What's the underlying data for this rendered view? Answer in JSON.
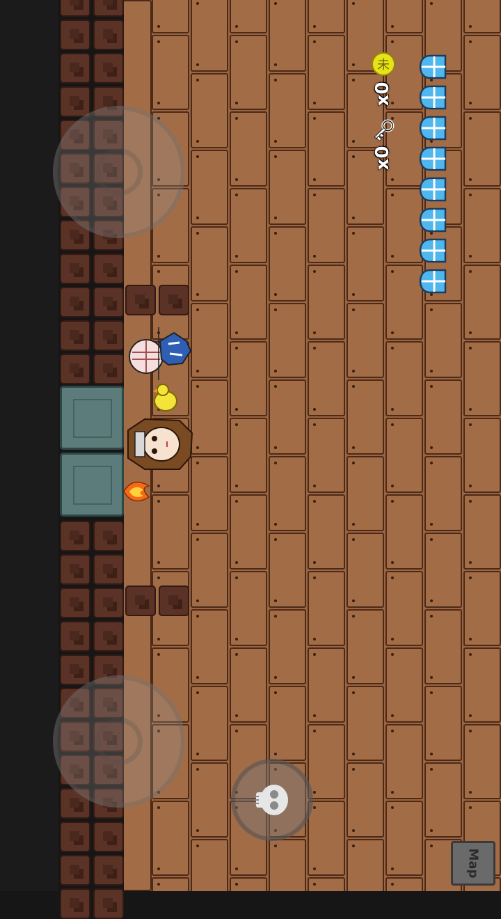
{
  "hud": {
    "coin_count": "x0",
    "key_count": "x0",
    "shields": 8,
    "coin_glyph": "未"
  },
  "buttons": {
    "map_label": "Map"
  },
  "icons": [
    "coin-icon",
    "key-icon",
    "shield-icon",
    "skull-icon",
    "fire-icon",
    "duck-icon"
  ],
  "colors": {
    "floor": "#9c6440",
    "brick": "#5b3326",
    "door": "#5b7c7a",
    "shield": "#4fb7ee",
    "coin": "#e8e21a"
  }
}
